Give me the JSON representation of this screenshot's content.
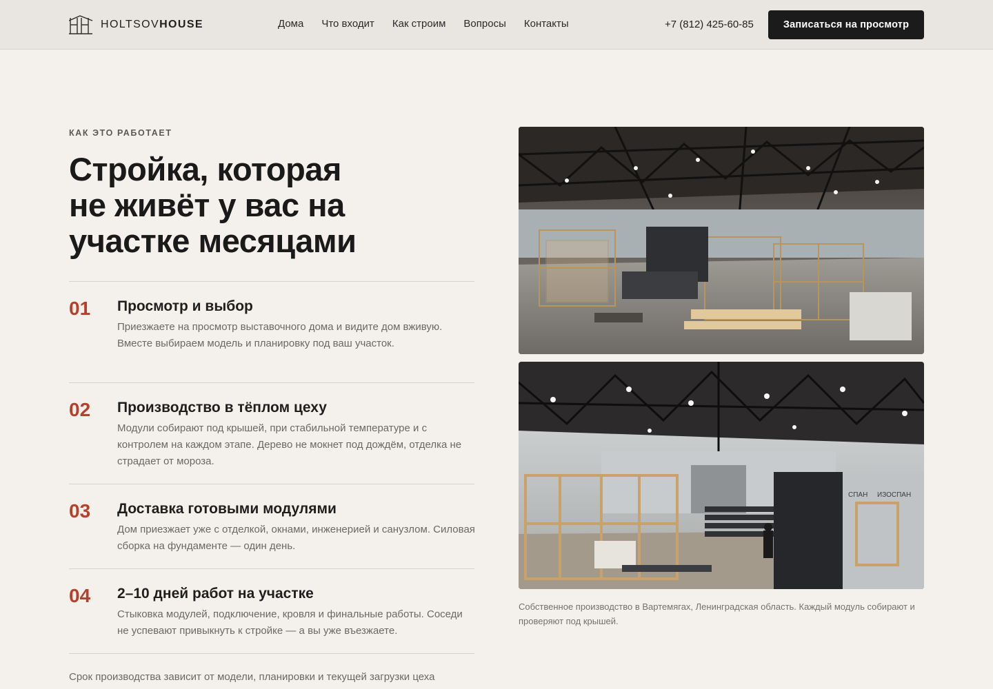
{
  "header": {
    "logo_light": "HOLTSOV",
    "logo_bold": "HOUSE",
    "nav": [
      "Дома",
      "Что входит",
      "Как строим",
      "Вопросы",
      "Контакты"
    ],
    "phone": "+7 (812) 425-60-85",
    "cta_label": "Записаться на просмотр"
  },
  "section": {
    "eyebrow": "КАК ЭТО РАБОТАЕТ",
    "headline_lines": [
      "Стройка, которая",
      "не живёт у вас на",
      "участке месяцами"
    ],
    "steps": [
      {
        "num": "01",
        "title": "Просмотр и выбор",
        "desc": "Приезжаете на просмотр выставочного дома и видите дом вживую. Вместе выбираем модель и планировку под ваш участок."
      },
      {
        "num": "02",
        "title": "Производство в тёплом цеху",
        "desc": "Модули собирают под крышей, при стабильной температуре и с контролем на каждом этапе. Дерево не мокнет под дождём, отделка не страдает от мороза."
      },
      {
        "num": "03",
        "title": "Доставка готовыми модулями",
        "desc": "Дом приезжает уже с отделкой, окнами, инженерией и санузлом. Силовая сборка на фундаменте — один день."
      },
      {
        "num": "04",
        "title": "2–10 дней работ на участке",
        "desc": "Стыковка модулей, подключение, кровля и финальные работы. Соседи не успевают привыкнуть к стройке — а вы уже въезжаете."
      }
    ],
    "footnote": "Срок производства зависит от модели, планировки и текущей загрузки цеха",
    "caption": "Собственное производство в Вартемягах, Ленинградская область. Каждый модуль собирают и проверяют под крышей.",
    "photo_sign_1": "СПАН",
    "photo_sign_2": "ИЗОСПАН"
  },
  "colors": {
    "accent": "#b8402b",
    "background": "#f4f1ec",
    "header_bg": "#e9e6e1",
    "cta_bg": "#1b1b1b"
  }
}
